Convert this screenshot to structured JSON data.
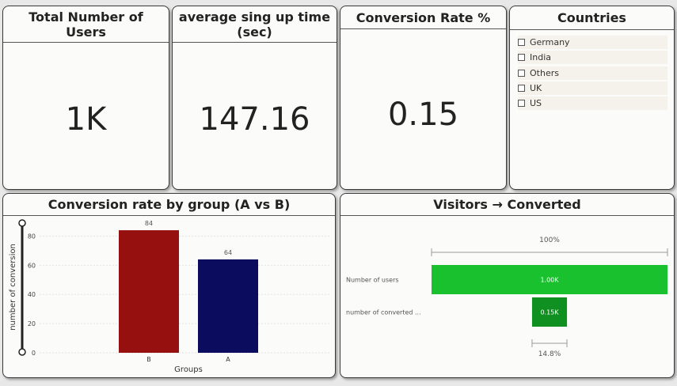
{
  "kpis": [
    {
      "title": "Total Number of Users",
      "value": "1K"
    },
    {
      "title": "average sing up time (sec)",
      "value": "147.16"
    },
    {
      "title": "Conversion Rate %",
      "value": "0.15"
    }
  ],
  "slicer": {
    "title": "Countries",
    "items": [
      "Germany",
      "India",
      "Others",
      "UK",
      "US"
    ]
  },
  "bar_chart": {
    "title": "Conversion rate by group (A vs B)",
    "chart_data": {
      "type": "bar",
      "categories": [
        "B",
        "A"
      ],
      "values": [
        84,
        64
      ],
      "data_labels": [
        "84",
        "64"
      ],
      "xlabel": "Groups",
      "ylabel": "number of conversion",
      "ylim": [
        0,
        90
      ],
      "yticks": [
        0,
        20,
        40,
        60,
        80
      ],
      "colors": [
        "#961010",
        "#0c0c5e"
      ],
      "grid": true
    }
  },
  "funnel": {
    "title": "Visitors → Converted",
    "top_percent": "100%",
    "bottom_percent": "14.8%",
    "colors": [
      "#19c12f",
      "#109021"
    ],
    "chart_data": {
      "type": "bar",
      "categories": [
        "Number of users",
        "number of converted ..."
      ],
      "values": [
        1000,
        148
      ],
      "data_labels": [
        "1.00K",
        "0.15K"
      ]
    }
  }
}
